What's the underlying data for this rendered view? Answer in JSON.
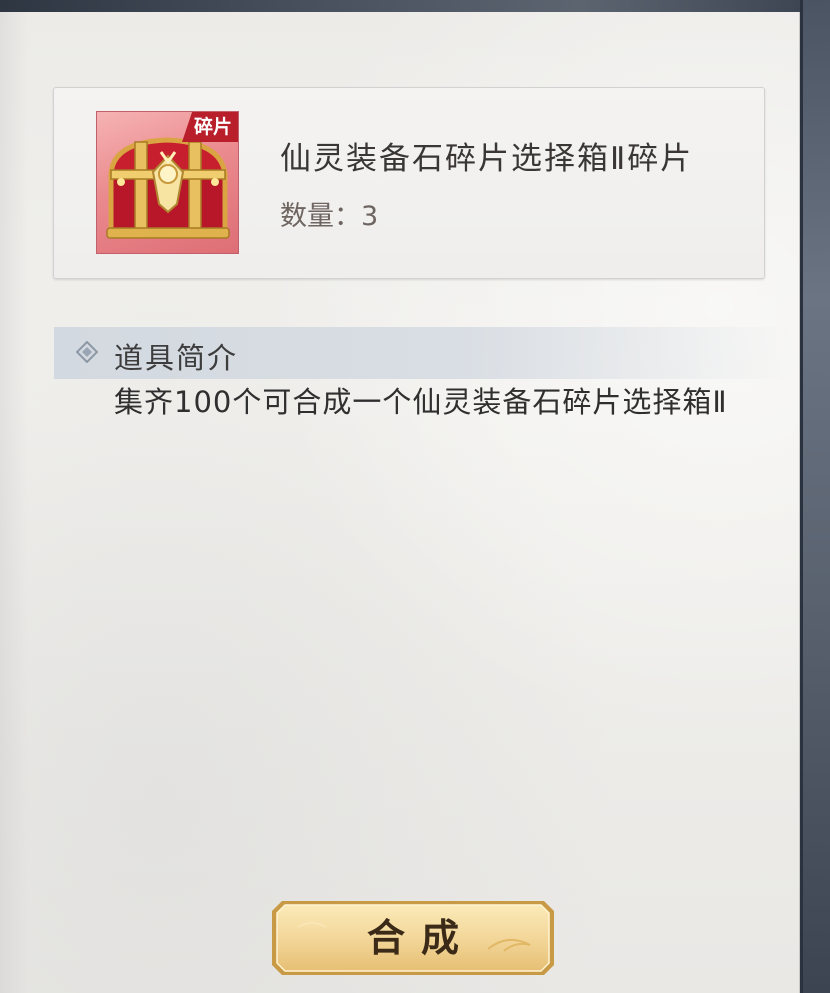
{
  "item": {
    "badge": "碎片",
    "name": "仙灵装备石碎片选择箱Ⅱ碎片",
    "quantity_label": "数量：3",
    "icon": "treasure-chest-icon"
  },
  "section": {
    "title": "道具简介",
    "icon": "diamond-bullet-icon"
  },
  "description": "集齐100个可合成一个仙灵装备石碎片选择箱Ⅱ",
  "button": {
    "compose_label": "合成"
  },
  "colors": {
    "badge": "#b81f2b",
    "icon_bg": "#ea8a8e",
    "button_gold": "#f3d79a"
  }
}
